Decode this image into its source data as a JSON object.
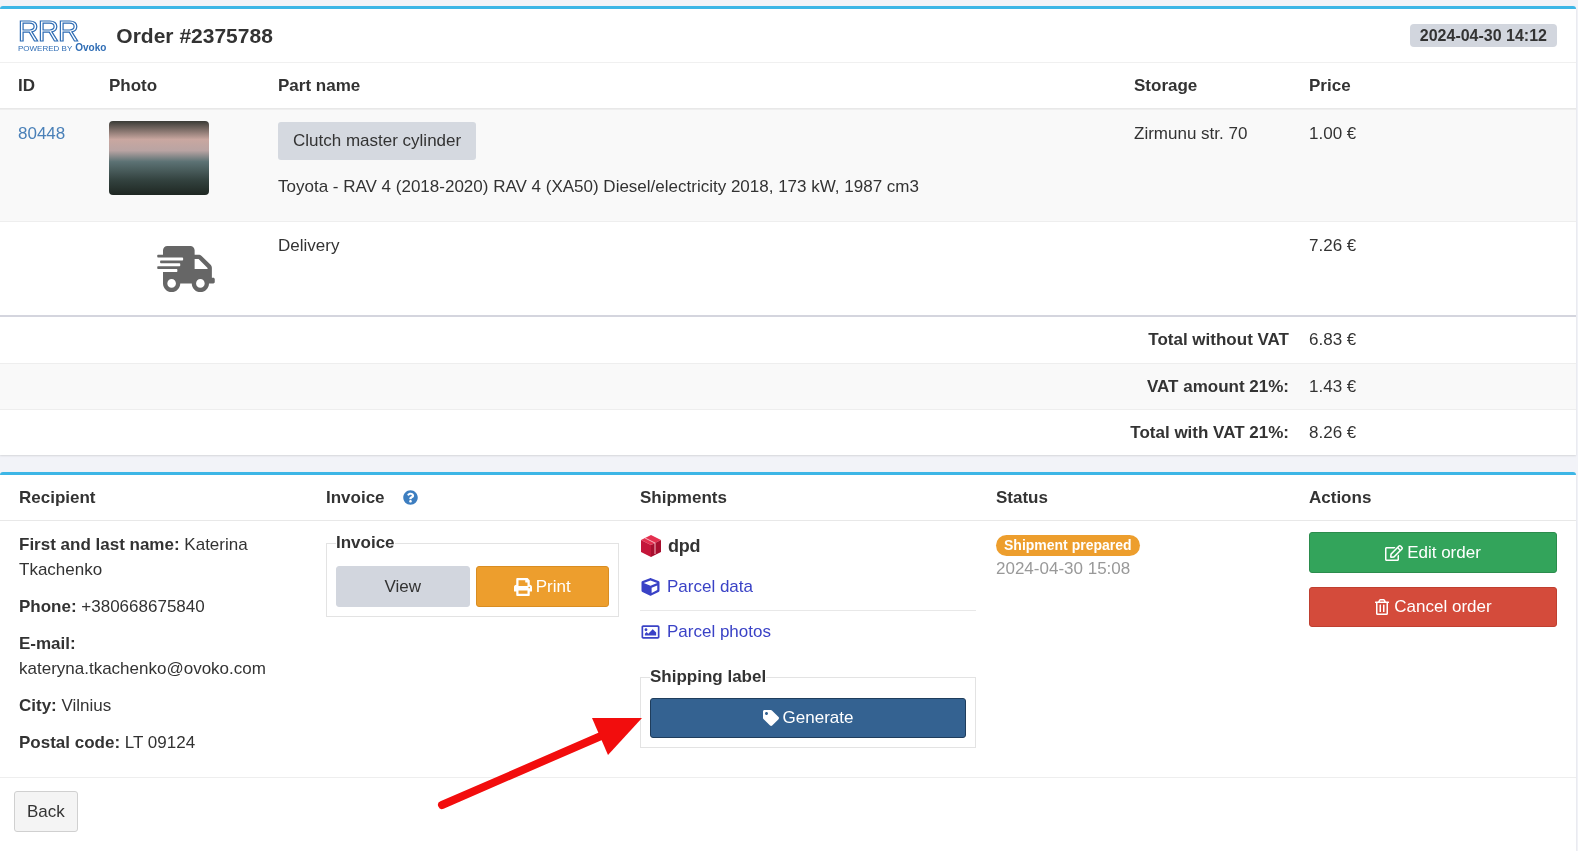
{
  "header": {
    "logo": {
      "mark": "RRR",
      "tagline": "POWERED BY",
      "brand": "Ovoko"
    },
    "title": "Order #2375788",
    "date": "2024-04-30 14:12"
  },
  "items": {
    "columns": [
      "ID",
      "Photo",
      "Part name",
      "Storage",
      "Price"
    ],
    "rows": [
      {
        "kind": "part",
        "id": "80448",
        "part_name": "Clutch master cylinder",
        "description": "Toyota - RAV 4 (2018-2020) RAV 4 (XA50) Diesel/electricity 2018, 173 kW, 1987 cm3",
        "storage": "Zirmunu str. 70",
        "price": "1.00 €"
      },
      {
        "kind": "delivery",
        "part_name": "Delivery",
        "price": "7.26 €"
      }
    ]
  },
  "totals": [
    {
      "label": "Total without VAT",
      "value": "6.83 €"
    },
    {
      "label": "VAT amount 21%:",
      "value": "1.43 €"
    },
    {
      "label": "Total with VAT 21%:",
      "value": "8.26 €"
    }
  ],
  "details": {
    "columns": [
      {
        "label": "Recipient",
        "help": false
      },
      {
        "label": "Invoice",
        "help": true
      },
      {
        "label": "Shipments",
        "help": false
      },
      {
        "label": "Status",
        "help": false
      },
      {
        "label": "Actions",
        "help": false
      }
    ],
    "recipient": [
      "**First and last name:** Katerina Tkachenko",
      "**Phone:** +380668675840",
      "**E-mail:** kateryna.tkachenko@ovoko.com",
      "**City:** Vilnius",
      "**Postal code:** LT 09124"
    ],
    "invoice": {
      "legend": "Invoice",
      "buttons": [
        {
          "kind": "view",
          "label": "View"
        },
        {
          "kind": "print",
          "label": "Print"
        }
      ]
    },
    "shipments": {
      "carrier": "dpd",
      "links": [
        {
          "kind": "data",
          "label": "Parcel data"
        },
        {
          "kind": "photos",
          "label": "Parcel photos"
        }
      ],
      "shipping_label": {
        "legend": "Shipping label",
        "button": "Generate"
      }
    },
    "status": {
      "label": "Shipment prepared",
      "date": "2024-04-30 15:08"
    },
    "actions": [
      {
        "kind": "edit",
        "label": "Edit order"
      },
      {
        "kind": "cancel",
        "label": "Cancel order"
      }
    ]
  },
  "footer": {
    "back": "Back"
  }
}
